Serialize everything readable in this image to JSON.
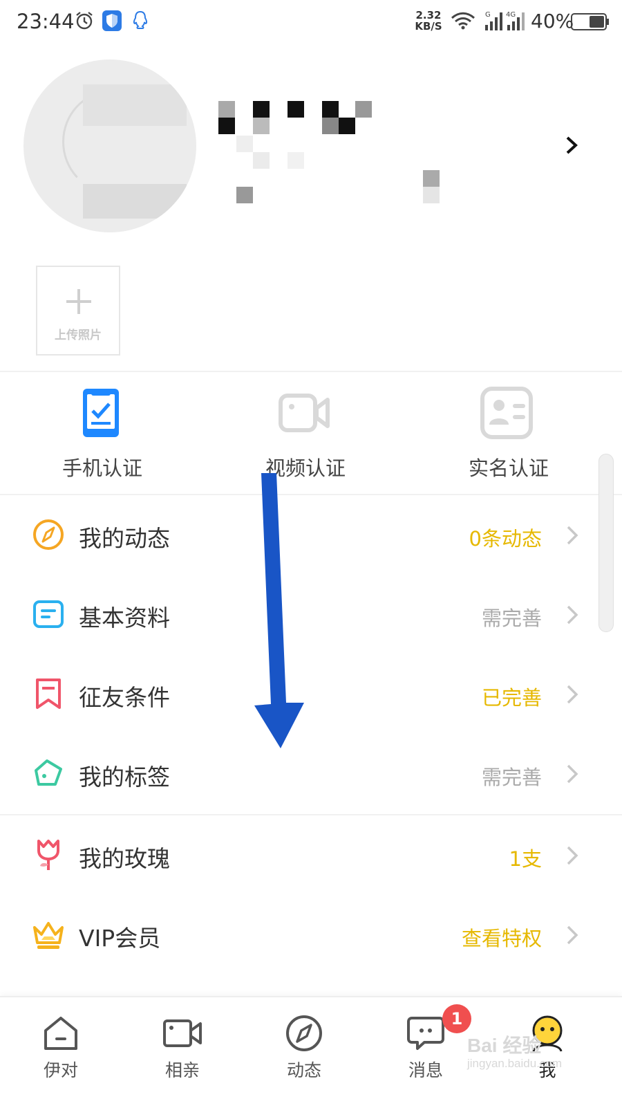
{
  "status_bar": {
    "time": "23:44",
    "net_speed_value": "2.32",
    "net_speed_unit": "KB/S",
    "battery_percent": "40%",
    "signal_label_1": "G",
    "signal_label_2": "4G"
  },
  "profile": {
    "upload_photo_label": "上传照片"
  },
  "verification": [
    {
      "label": "手机认证",
      "icon": "phone-check-icon",
      "color": "#1e88ff",
      "verified": true
    },
    {
      "label": "视频认证",
      "icon": "video-camera-icon",
      "color": "#d9d9d9",
      "verified": false
    },
    {
      "label": "实名认证",
      "icon": "id-card-icon",
      "color": "#d9d9d9",
      "verified": false
    }
  ],
  "menu": [
    {
      "label": "我的动态",
      "value": "0条动态",
      "icon": "compass-icon",
      "icon_color": "#f5a623",
      "value_color": "#e6b800"
    },
    {
      "label": "基本资料",
      "value": "需完善",
      "icon": "profile-card-icon",
      "icon_color": "#2ab0ef",
      "value_color": "#aaaaaa"
    },
    {
      "label": "征友条件",
      "value": "已完善",
      "icon": "bookmark-icon",
      "icon_color": "#f0556a",
      "value_color": "#e6b800"
    },
    {
      "label": "我的标签",
      "value": "需完善",
      "icon": "tag-icon",
      "icon_color": "#3cc9a1",
      "value_color": "#aaaaaa"
    },
    {
      "label": "我的玫瑰",
      "value": "1支",
      "icon": "rose-icon",
      "icon_color": "#f0556a",
      "value_color": "#e6b800"
    },
    {
      "label": "VIP会员",
      "value": "查看特权",
      "icon": "crown-icon",
      "icon_color": "#f5b21c",
      "value_color": "#e6b800"
    }
  ],
  "bottom_nav": [
    {
      "label": "伊对",
      "icon": "home-icon"
    },
    {
      "label": "相亲",
      "icon": "video-icon"
    },
    {
      "label": "动态",
      "icon": "compass-icon"
    },
    {
      "label": "消息",
      "icon": "chat-icon",
      "badge": "1"
    },
    {
      "label": "我",
      "icon": "me-face-icon",
      "active": true
    }
  ],
  "watermark": {
    "line1": "Bai 经验",
    "line2": "jingyan.baidu.com"
  },
  "colors": {
    "accent_blue": "#1e88ff",
    "annotation_arrow": "#1955c6",
    "value_yellow": "#e6b800",
    "value_gray": "#aaaaaa",
    "badge_red": "#f04f4f",
    "active_yellow": "#ffd43b"
  }
}
